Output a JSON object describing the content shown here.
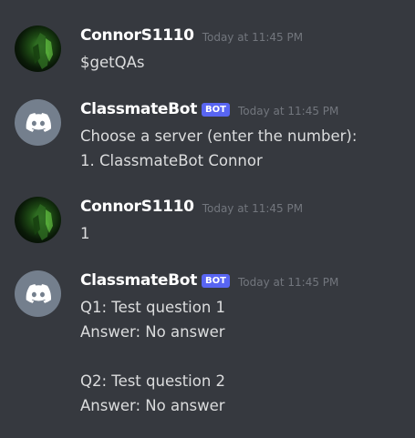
{
  "messages": [
    {
      "author": "ConnorS1110",
      "timestamp": "Today at 11:45 PM",
      "lines": [
        "$getQAs"
      ]
    },
    {
      "author": "ClassmateBot",
      "badge": "BOT",
      "timestamp": "Today at 11:45 PM",
      "lines": [
        "Choose a server (enter the number):",
        "1. ClassmateBot Connor"
      ]
    },
    {
      "author": "ConnorS1110",
      "timestamp": "Today at 11:45 PM",
      "lines": [
        "1"
      ]
    },
    {
      "author": "ClassmateBot",
      "badge": "BOT",
      "timestamp": "Today at 11:45 PM",
      "lines": [
        "Q1: Test question 1",
        "Answer: No answer",
        "",
        "Q2: Test question 2",
        "Answer: No answer"
      ]
    }
  ],
  "colors": {
    "background": "#36393f",
    "username": "#ffffff",
    "text": "#dcddde",
    "timestamp": "#72767d",
    "bot_badge": "#5865f2",
    "bot_avatar": "#747f8d"
  },
  "icons": {
    "user_avatar": "user-avatar-photo",
    "bot_avatar": "discord-logo-icon"
  }
}
